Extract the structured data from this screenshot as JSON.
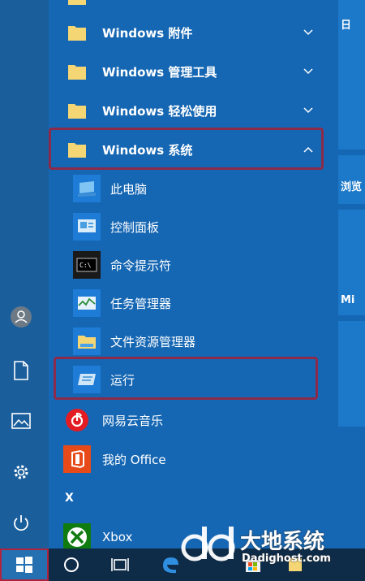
{
  "start_menu": {
    "folders": [
      {
        "label": "Windows 附件"
      },
      {
        "label": "Windows 管理工具"
      },
      {
        "label": "Windows 轻松使用"
      },
      {
        "label": "Windows 系统"
      }
    ],
    "system_items": [
      {
        "label": "此电脑"
      },
      {
        "label": "控制面板"
      },
      {
        "label": "命令提示符"
      },
      {
        "label": "任务管理器"
      },
      {
        "label": "文件资源管理器"
      },
      {
        "label": "运行"
      }
    ],
    "apps": [
      {
        "label": "网易云音乐"
      },
      {
        "label": "我的 Office"
      }
    ],
    "section_letter": "X",
    "xbox_label": "Xbox"
  },
  "tiles": {
    "tile1_text": "日",
    "tile2_text": "浏览",
    "tile3_text": "Mi"
  },
  "watermark": {
    "title": "大地系统",
    "url": "Dadighost.com"
  },
  "colors": {
    "highlight": "#8d2a4a",
    "netease_red": "#e31c23",
    "office_orange": "#e64a19",
    "xbox_green": "#107c10"
  }
}
